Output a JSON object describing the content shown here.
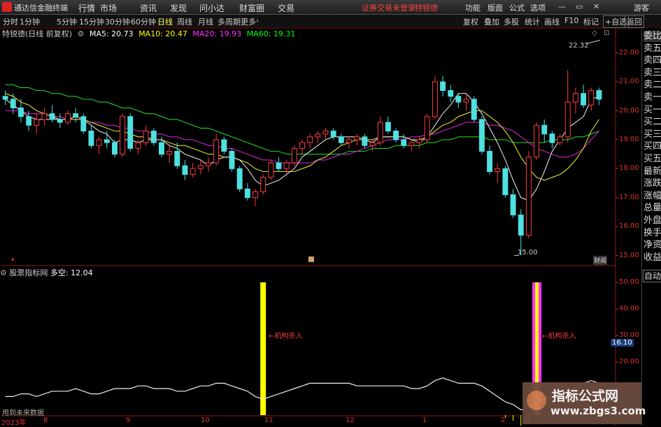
{
  "menubar": {
    "title": "通达信金融终端",
    "items": [
      "行情",
      "市场",
      "资讯",
      "发现",
      "问小达",
      "财富圈",
      "交易"
    ],
    "warning": "证券交易未登录",
    "stock_name": "特锐德",
    "right_items": [
      "功能",
      "版面",
      "公式",
      "选项"
    ],
    "guest": "游客"
  },
  "periodbar": {
    "periods": [
      "分时",
      "1分钟",
      "5分钟",
      "15分钟",
      "30分钟",
      "60分钟",
      "日线",
      "周线",
      "月线",
      "多周期",
      "更多"
    ],
    "active": "日线",
    "tools": [
      "复权",
      "叠加",
      "多股",
      "统计",
      "画线",
      "F10",
      "标记",
      "+自选",
      "返回"
    ]
  },
  "infoline": {
    "name": "特锐德(日线 前复权)",
    "ma5": "MA5: 20.73",
    "ma10": "MA10: 20.47",
    "ma20": "MA20: 19.93",
    "ma60": "MA60: 19.31",
    "colors": {
      "ma5": "#ffffff",
      "ma10": "#ffff00",
      "ma20": "#ff00ff",
      "ma60": "#00ff00"
    }
  },
  "right_panel": {
    "items": [
      "委比",
      "卖五",
      "卖四",
      "卖三",
      "卖二",
      "卖一",
      "买一",
      "买二",
      "买三",
      "买四",
      "买五",
      "最新",
      "涨跌",
      "涨幅",
      "总量",
      "外盘",
      "换手",
      "净资",
      "收益"
    ],
    "auto": "自动"
  },
  "main_chart": {
    "y_labels": [
      "22.00",
      "21.00",
      "20.00",
      "19.00",
      "18.00",
      "17.00",
      "16.00",
      "15.00"
    ],
    "high_label": "22.32",
    "low_label": "15.00",
    "cwjx_label": "财闻"
  },
  "sub_chart": {
    "title": "股票指标网",
    "indicator": "多空: 12.04",
    "y_labels": [
      "50.00",
      "40.00",
      "30.00",
      "20.00",
      "10.00",
      "0.00"
    ],
    "current_value": "16.10",
    "signal_label": "机构杀入",
    "future_note": "用到未来数据"
  },
  "x_axis": {
    "labels": [
      "2023年",
      "8",
      "9",
      "10",
      "11",
      "12",
      "1",
      "2"
    ]
  },
  "watermark": {
    "line1": "指标公式网",
    "line2": "www.zbgs3.com"
  },
  "chart_data": {
    "type": "candlestick",
    "title": "特锐德(日线 前复权)",
    "ylim": [
      14.7,
      22.5
    ],
    "y_ticks": [
      15,
      16,
      17,
      18,
      19,
      20,
      21,
      22
    ],
    "ohlc": [
      [
        20.5,
        20.7,
        20.2,
        20.4
      ],
      [
        20.4,
        20.6,
        19.9,
        20.1
      ],
      [
        20.1,
        20.4,
        19.6,
        19.8
      ],
      [
        19.8,
        20.0,
        19.3,
        19.5
      ],
      [
        19.5,
        19.9,
        19.2,
        19.7
      ],
      [
        19.7,
        20.1,
        19.5,
        19.9
      ],
      [
        19.9,
        20.2,
        19.6,
        19.7
      ],
      [
        19.7,
        19.9,
        19.4,
        19.6
      ],
      [
        19.6,
        20.0,
        19.5,
        19.9
      ],
      [
        19.9,
        20.1,
        19.6,
        19.8
      ],
      [
        19.8,
        19.9,
        19.2,
        19.3
      ],
      [
        19.3,
        19.5,
        18.7,
        18.8
      ],
      [
        18.8,
        19.1,
        18.5,
        19.0
      ],
      [
        19.0,
        19.3,
        18.7,
        18.9
      ],
      [
        18.9,
        19.0,
        18.4,
        18.5
      ],
      [
        18.5,
        19.9,
        18.4,
        19.8
      ],
      [
        19.8,
        19.9,
        18.6,
        18.7
      ],
      [
        18.7,
        19.0,
        18.5,
        18.9
      ],
      [
        18.9,
        19.5,
        18.8,
        19.3
      ],
      [
        19.3,
        19.4,
        18.8,
        18.9
      ],
      [
        18.9,
        19.1,
        18.4,
        18.5
      ],
      [
        18.5,
        18.8,
        18.2,
        18.6
      ],
      [
        18.6,
        18.9,
        18.0,
        18.1
      ],
      [
        18.1,
        18.3,
        17.6,
        17.8
      ],
      [
        17.8,
        18.2,
        17.7,
        18.0
      ],
      [
        18.0,
        18.3,
        17.8,
        18.1
      ],
      [
        18.1,
        18.4,
        17.9,
        18.2
      ],
      [
        18.2,
        19.2,
        18.1,
        19.0
      ],
      [
        19.0,
        19.1,
        18.5,
        18.6
      ],
      [
        18.6,
        18.7,
        17.9,
        18.0
      ],
      [
        18.0,
        18.1,
        17.2,
        17.3
      ],
      [
        17.3,
        17.5,
        16.9,
        17.0
      ],
      [
        17.0,
        17.3,
        16.7,
        17.2
      ],
      [
        17.2,
        17.8,
        17.1,
        17.7
      ],
      [
        17.7,
        18.3,
        17.6,
        18.2
      ],
      [
        18.2,
        18.4,
        17.9,
        18.0
      ],
      [
        18.0,
        18.3,
        17.8,
        18.2
      ],
      [
        18.2,
        18.8,
        18.1,
        18.7
      ],
      [
        18.7,
        19.0,
        18.5,
        18.9
      ],
      [
        18.9,
        19.2,
        18.7,
        19.1
      ],
      [
        19.1,
        19.3,
        18.9,
        19.2
      ],
      [
        19.2,
        19.4,
        19.0,
        19.3
      ],
      [
        19.3,
        19.4,
        19.0,
        19.1
      ],
      [
        19.1,
        19.2,
        18.8,
        18.9
      ],
      [
        18.9,
        19.1,
        18.7,
        19.0
      ],
      [
        19.0,
        19.2,
        18.8,
        19.1
      ],
      [
        19.1,
        19.2,
        18.7,
        18.8
      ],
      [
        18.8,
        19.0,
        18.6,
        18.9
      ],
      [
        18.9,
        19.8,
        18.8,
        19.6
      ],
      [
        19.6,
        19.8,
        19.2,
        19.3
      ],
      [
        19.3,
        19.4,
        18.9,
        19.0
      ],
      [
        19.0,
        19.2,
        18.7,
        18.8
      ],
      [
        18.8,
        19.0,
        18.6,
        18.9
      ],
      [
        18.9,
        19.1,
        18.7,
        19.0
      ],
      [
        19.0,
        19.9,
        18.9,
        19.8
      ],
      [
        19.8,
        21.2,
        19.7,
        21.0
      ],
      [
        21.0,
        21.2,
        20.5,
        20.7
      ],
      [
        20.7,
        20.9,
        20.3,
        20.5
      ],
      [
        20.5,
        20.6,
        20.1,
        20.3
      ],
      [
        20.3,
        20.6,
        20.0,
        20.4
      ],
      [
        20.4,
        20.5,
        19.6,
        19.7
      ],
      [
        19.7,
        19.8,
        18.5,
        18.6
      ],
      [
        18.6,
        18.8,
        17.8,
        17.9
      ],
      [
        17.9,
        18.2,
        17.5,
        18.0
      ],
      [
        18.0,
        18.1,
        17.0,
        17.1
      ],
      [
        17.1,
        17.3,
        16.3,
        16.4
      ],
      [
        16.4,
        16.6,
        15.0,
        15.7
      ],
      [
        15.7,
        18.6,
        15.6,
        18.4
      ],
      [
        18.4,
        19.6,
        18.3,
        19.5
      ],
      [
        19.5,
        19.7,
        18.9,
        19.2
      ],
      [
        19.2,
        19.3,
        18.7,
        18.9
      ],
      [
        18.9,
        19.2,
        18.8,
        19.1
      ],
      [
        19.1,
        21.4,
        18.9,
        20.3
      ],
      [
        20.3,
        20.8,
        19.9,
        20.6
      ],
      [
        20.6,
        20.9,
        20.1,
        20.2
      ],
      [
        20.2,
        20.8,
        20.0,
        20.7
      ],
      [
        20.7,
        20.8,
        20.2,
        20.4
      ]
    ],
    "ma5": [
      20.4,
      20.2,
      20.0,
      19.8,
      19.7,
      19.7,
      19.7,
      19.7,
      19.7,
      19.8,
      19.7,
      19.5,
      19.3,
      19.2,
      18.9,
      19.0,
      19.0,
      18.9,
      19.0,
      19.0,
      19.0,
      18.8,
      18.7,
      18.5,
      18.4,
      18.3,
      18.1,
      18.3,
      18.4,
      18.4,
      18.3,
      18.0,
      17.6,
      17.4,
      17.5,
      17.6,
      17.8,
      18.0,
      18.4,
      18.6,
      18.8,
      19.0,
      19.1,
      19.1,
      19.1,
      19.1,
      19.0,
      18.9,
      19.1,
      19.1,
      19.1,
      19.1,
      19.0,
      18.9,
      19.1,
      19.5,
      19.9,
      20.2,
      20.6,
      20.6,
      20.3,
      19.9,
      19.4,
      18.9,
      18.3,
      17.6,
      17.0,
      16.9,
      17.3,
      17.9,
      18.6,
      19.0,
      19.4,
      19.6,
      19.8,
      20.4,
      20.5
    ],
    "ma10": [
      20.6,
      20.5,
      20.3,
      20.2,
      20.0,
      19.9,
      19.8,
      19.7,
      19.7,
      19.7,
      19.7,
      19.6,
      19.5,
      19.4,
      19.3,
      19.3,
      19.2,
      19.1,
      19.1,
      19.0,
      19.0,
      18.9,
      18.8,
      18.8,
      18.7,
      18.6,
      18.5,
      18.5,
      18.4,
      18.4,
      18.3,
      18.2,
      18.0,
      17.9,
      17.9,
      17.9,
      17.9,
      17.9,
      18.0,
      18.1,
      18.3,
      18.4,
      18.6,
      18.8,
      18.9,
      19.0,
      19.0,
      19.0,
      19.1,
      19.1,
      19.1,
      19.1,
      19.0,
      19.0,
      19.1,
      19.3,
      19.5,
      19.6,
      19.8,
      19.9,
      20.0,
      20.0,
      19.8,
      19.6,
      19.3,
      18.9,
      18.4,
      18.0,
      17.7,
      17.6,
      17.7,
      17.8,
      18.0,
      18.3,
      18.7,
      19.3,
      19.7
    ],
    "ma20": [
      20.0,
      20.0,
      20.0,
      19.9,
      19.9,
      19.9,
      19.8,
      19.8,
      19.7,
      19.7,
      19.7,
      19.6,
      19.6,
      19.5,
      19.5,
      19.4,
      19.4,
      19.3,
      19.3,
      19.2,
      19.2,
      19.1,
      19.1,
      19.0,
      19.0,
      18.9,
      18.8,
      18.8,
      18.7,
      18.7,
      18.6,
      18.5,
      18.4,
      18.3,
      18.3,
      18.2,
      18.2,
      18.2,
      18.2,
      18.2,
      18.3,
      18.3,
      18.4,
      18.5,
      18.5,
      18.6,
      18.7,
      18.8,
      18.9,
      19.0,
      19.0,
      19.0,
      19.1,
      19.1,
      19.2,
      19.2,
      19.3,
      19.4,
      19.5,
      19.6,
      19.6,
      19.6,
      19.5,
      19.5,
      19.4,
      19.3,
      19.1,
      18.9,
      18.7,
      18.6,
      18.5,
      18.4,
      18.4,
      18.5,
      18.7,
      19.0,
      19.3
    ],
    "ma60": [
      20.9,
      20.9,
      20.8,
      20.8,
      20.7,
      20.7,
      20.6,
      20.6,
      20.5,
      20.5,
      20.4,
      20.4,
      20.3,
      20.3,
      20.2,
      20.1,
      20.1,
      20.0,
      19.9,
      19.9,
      19.8,
      19.7,
      19.7,
      19.6,
      19.5,
      19.4,
      19.4,
      19.3,
      19.2,
      19.1,
      19.0,
      18.9,
      18.8,
      18.7,
      18.6,
      18.6,
      18.5,
      18.5,
      18.5,
      18.5,
      18.5,
      18.5,
      18.5,
      18.5,
      18.6,
      18.6,
      18.6,
      18.7,
      18.7,
      18.7,
      18.8,
      18.8,
      18.8,
      18.8,
      18.9,
      18.9,
      19.0,
      19.0,
      19.1,
      19.1,
      19.1,
      19.1,
      19.0,
      19.0,
      19.0,
      18.9,
      18.9,
      18.9,
      18.9,
      18.9,
      19.0,
      19.0,
      19.0,
      19.1,
      19.1,
      19.2,
      19.3
    ],
    "sub_ylim": [
      0,
      55
    ],
    "sub_ticks": [
      0,
      10,
      20,
      30,
      40,
      50
    ],
    "duokong": [
      7,
      7,
      8,
      8,
      7,
      8,
      9,
      9,
      9,
      10,
      9,
      8,
      8,
      9,
      10,
      10,
      10,
      11,
      11,
      10,
      10,
      10,
      9,
      9,
      10,
      11,
      11,
      12,
      12,
      11,
      10,
      9,
      7,
      6,
      7,
      8,
      9,
      10,
      11,
      12,
      12,
      12,
      12,
      12,
      12,
      11,
      11,
      11,
      11,
      11,
      11,
      11,
      10,
      10,
      11,
      13,
      14,
      13,
      12,
      12,
      12,
      11,
      9,
      7,
      5,
      4,
      2,
      3,
      5,
      6,
      7,
      8,
      9,
      10,
      12,
      13,
      12
    ],
    "signals": [
      {
        "index": 33,
        "label": "机构杀入",
        "color": "#ffff00"
      },
      {
        "index": 68,
        "label": "机构杀入",
        "color": "#ff33ff"
      }
    ]
  }
}
